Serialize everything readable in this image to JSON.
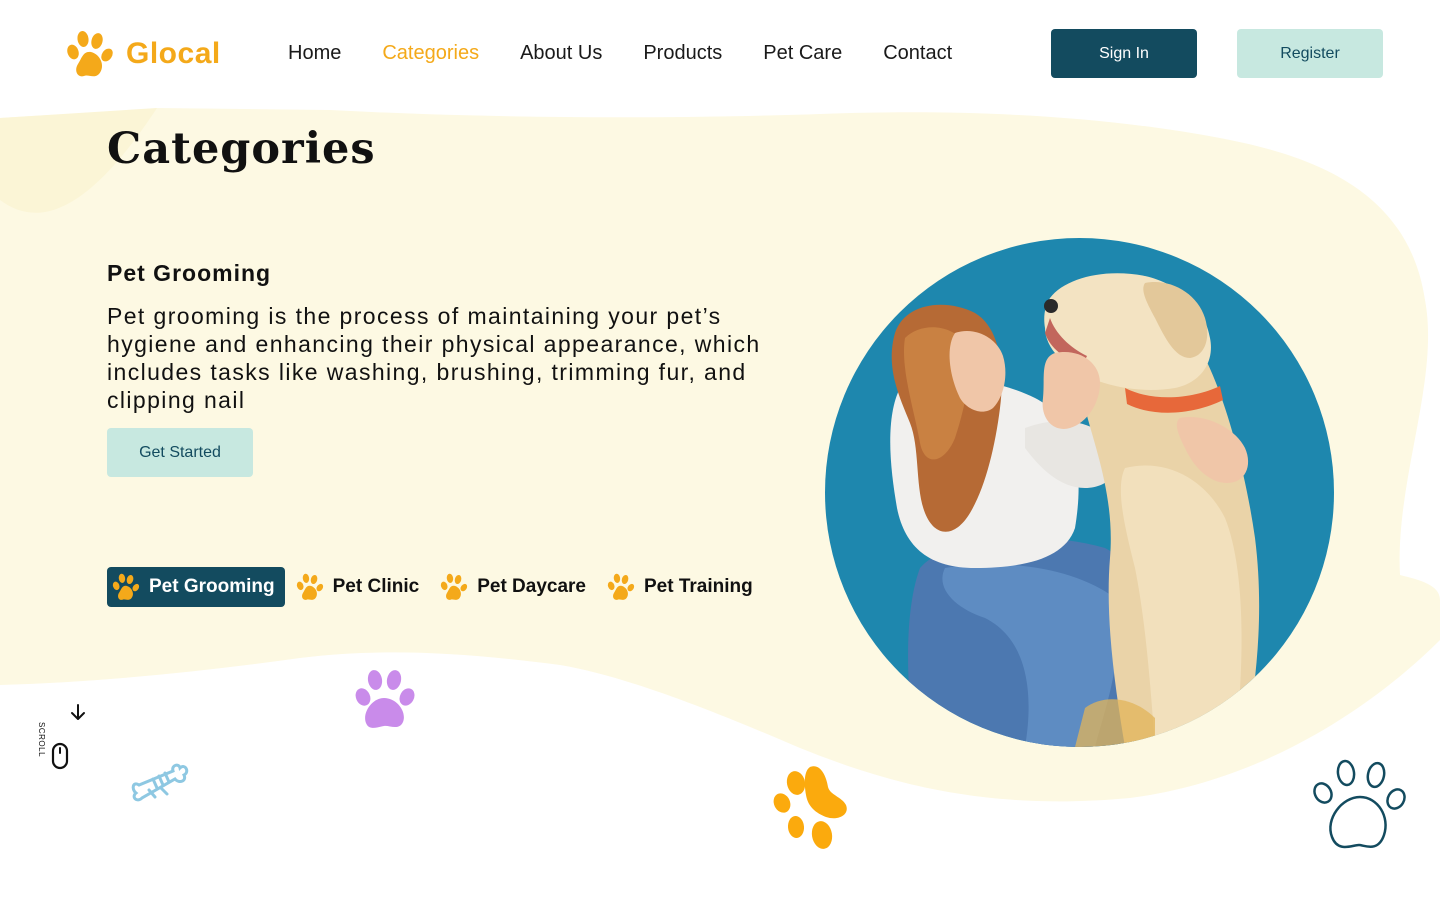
{
  "brand": {
    "name_prefix": "G",
    "name_rest": "local",
    "accent_color": "#F4A91A",
    "dark_color": "#134B5F",
    "mint_color": "#C7E8E0",
    "cream_color": "#FDF9E3"
  },
  "nav": {
    "items": [
      {
        "label": "Home",
        "active": false
      },
      {
        "label": "Categories",
        "active": true
      },
      {
        "label": "About Us",
        "active": false
      },
      {
        "label": "Products",
        "active": false
      },
      {
        "label": "Pet Care",
        "active": false
      },
      {
        "label": "Contact",
        "active": false
      }
    ]
  },
  "auth": {
    "signin_label": "Sign In",
    "register_label": "Register"
  },
  "page": {
    "title": "Categories"
  },
  "section": {
    "heading": "Pet Grooming",
    "description": "Pet grooming is the process of maintaining your pet’s hygiene and enhancing their physical appearance, which includes tasks like washing, brushing, trimming fur, and clipping nail",
    "cta_label": "Get Started"
  },
  "tabs": [
    {
      "label": "Pet Grooming",
      "active": true
    },
    {
      "label": "Pet Clinic",
      "active": false
    },
    {
      "label": "Pet Daycare",
      "active": false
    },
    {
      "label": "Pet Training",
      "active": false
    }
  ],
  "scroll": {
    "label": "SCROLL"
  },
  "icons": {
    "logo": "paw-icon",
    "tab": "paw-icon",
    "scroll": "mouse-icon",
    "scroll_arrow": "arrow-down-icon",
    "decor": [
      "bone-icon",
      "paw-icon"
    ]
  }
}
